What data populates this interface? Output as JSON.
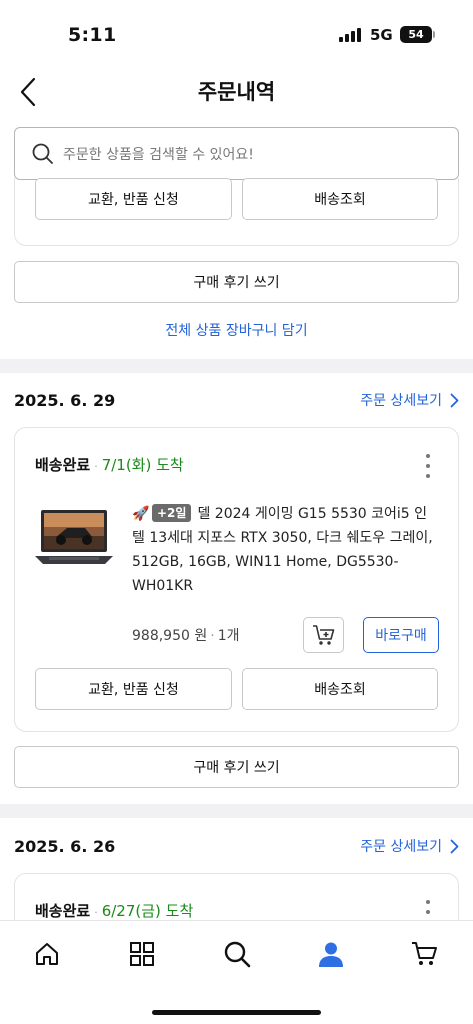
{
  "status_bar": {
    "time": "5:11",
    "network": "5G",
    "battery": "54"
  },
  "header": {
    "title": "주문내역"
  },
  "search": {
    "placeholder": "주문한 상품을 검색할 수 있어요!"
  },
  "previous_card": {
    "exchange_label": "교환, 반품 신청",
    "tracking_label": "배송조회",
    "review_label": "구매 후기 쓰기",
    "cart_all_label": "전체 상품 장바구니 담기"
  },
  "orders": [
    {
      "date": "2025. 6. 29",
      "detail_label": "주문 상세보기",
      "status": "배송완료",
      "arrival": "7/1(화) 도착",
      "badge": "+2일",
      "product_name": "델 2024 게이밍 G15 5530 코어i5 인텔 13세대 지포스 RTX 3050, 다크 쉐도우 그레이, 512GB, 16GB, WIN11 Home, DG5530-WH01KR",
      "price": "988,950 원",
      "quantity": "1개",
      "buy_now_label": "바로구매",
      "exchange_label": "교환, 반품 신청",
      "tracking_label": "배송조회",
      "review_label": "구매 후기 쓰기"
    },
    {
      "date": "2025. 6. 26",
      "detail_label": "주문 상세보기",
      "status": "배송완료",
      "arrival": "6/27(금) 도착"
    }
  ],
  "tab_bar": {
    "items": [
      "home-icon",
      "category-icon",
      "search-icon",
      "my-page-icon",
      "cart-icon"
    ],
    "active": "my-page-icon",
    "active_color": "#2f6fe4"
  },
  "colors": {
    "link": "#2463d9",
    "arrival": "#1a8a1a"
  }
}
